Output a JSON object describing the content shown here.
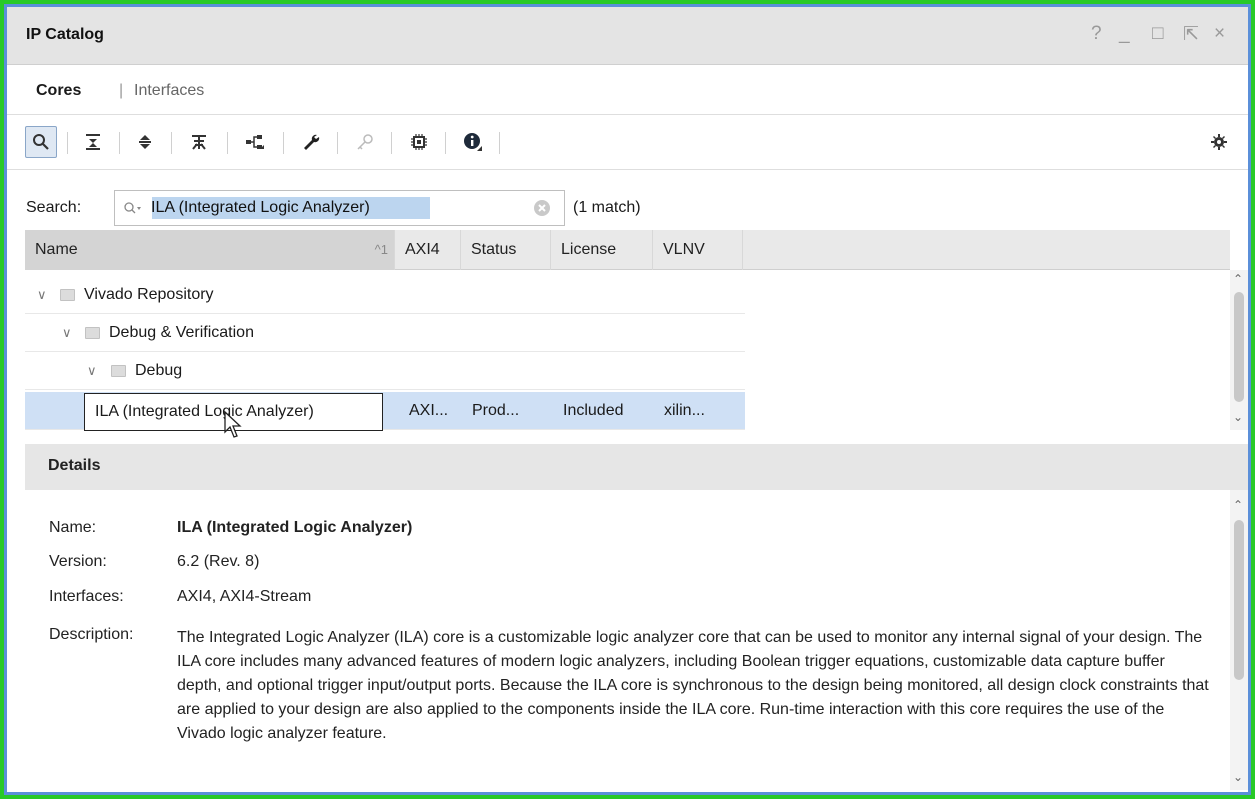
{
  "window": {
    "title": "IP Catalog",
    "controls": [
      "?",
      "_",
      "□",
      "⇱",
      "×"
    ]
  },
  "tabs": {
    "cores": "Cores",
    "separator": "|",
    "interfaces": "Interfaces"
  },
  "toolbar": {
    "icons": [
      "search-icon",
      "collapse-all-icon",
      "expand-all-icon",
      "filter-icon",
      "group-icon",
      "wrench-icon",
      "key-icon",
      "chip-icon",
      "info-icon",
      "settings-gear-icon"
    ]
  },
  "search": {
    "label": "Search:",
    "value": "ILA (Integrated Logic Analyzer)",
    "match_text": "(1 match)"
  },
  "table": {
    "columns": [
      {
        "label": "Name",
        "sort_indicator": "^1"
      },
      {
        "label": "AXI4"
      },
      {
        "label": "Status"
      },
      {
        "label": "License"
      },
      {
        "label": "VLNV"
      }
    ],
    "rows": [
      {
        "name": "Vivado Repository",
        "expanded": true
      },
      {
        "name": "Debug & Verification",
        "expanded": true
      },
      {
        "name": "Debug",
        "expanded": true
      },
      {
        "name": "ILA (Integrated Logic Analyzer)",
        "axi4": "AXI...",
        "status": "Prod...",
        "license": "Included",
        "vlnv": "xilin...",
        "selected": true
      }
    ]
  },
  "details": {
    "header": "Details",
    "name_label": "Name:",
    "name_value": "ILA (Integrated Logic Analyzer)",
    "version_label": "Version:",
    "version_value": "6.2 (Rev. 8)",
    "interfaces_label": "Interfaces:",
    "interfaces_value": "AXI4, AXI4-Stream",
    "description_label": "Description:",
    "description_value": "The Integrated Logic Analyzer (ILA) core is a customizable logic analyzer core that can be used to monitor any internal signal of your design. The ILA core includes many advanced features of modern logic analyzers, including Boolean trigger equations, customizable data capture buffer depth, and optional trigger input/output ports.  Because the ILA core is synchronous to the design being monitored, all design clock constraints that are applied to your design are also applied to the components inside the ILA core. Run-time interaction with this core requires the use of the Vivado logic analyzer feature."
  },
  "colors": {
    "accent_frame": "#28c928",
    "selection": "#cfe0f5",
    "header_bg": "#e4e4e4"
  }
}
